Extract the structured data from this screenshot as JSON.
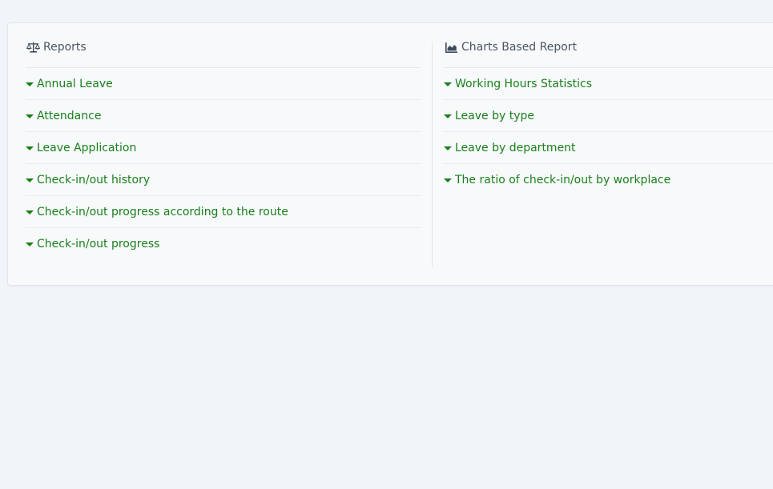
{
  "reports": {
    "title": "Reports",
    "icon": "balance-scale-icon",
    "items": [
      {
        "label": "Annual Leave"
      },
      {
        "label": "Attendance"
      },
      {
        "label": "Leave Application"
      },
      {
        "label": "Check-in/out history"
      },
      {
        "label": "Check-in/out progress according to the route"
      },
      {
        "label": "Check-in/out progress"
      }
    ]
  },
  "charts": {
    "title": "Charts Based Report",
    "icon": "area-chart-icon",
    "items": [
      {
        "label": "Working Hours Statistics"
      },
      {
        "label": "Leave by type"
      },
      {
        "label": "Leave by department"
      },
      {
        "label": "The ratio of check-in/out by workplace"
      }
    ]
  },
  "colors": {
    "link": "#1a7f1a",
    "background": "#f1f4f8",
    "card": "#f7f9fb"
  }
}
